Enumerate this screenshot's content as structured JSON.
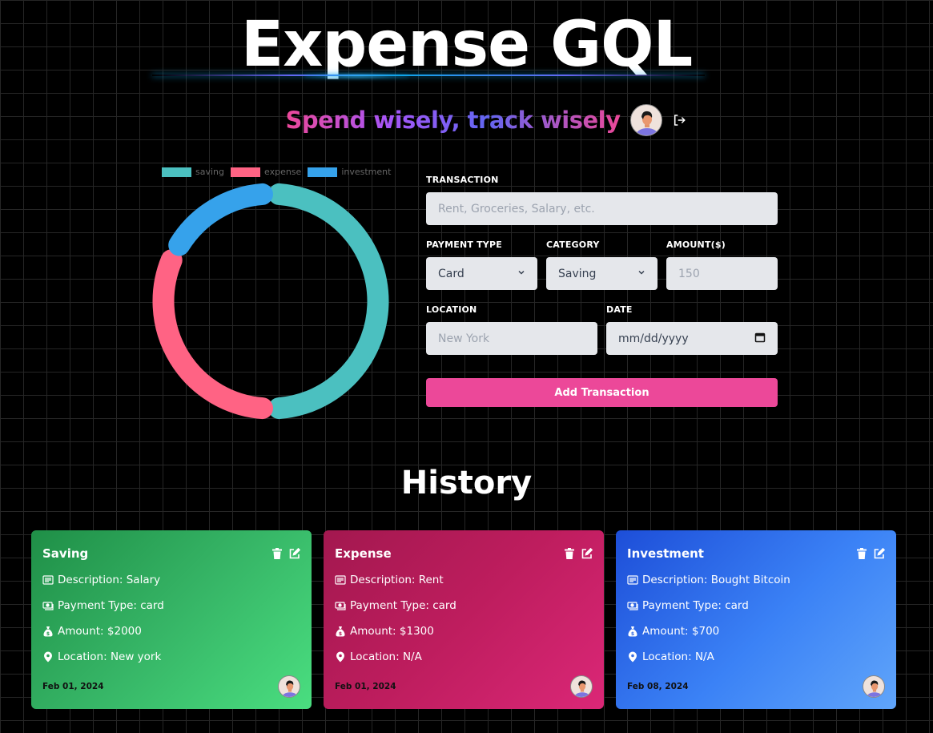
{
  "header": {
    "title": "Expense GQL",
    "subtitle": "Spend wisely, track wisely",
    "avatar_icon": "user-avatar",
    "logout_icon": "logout-icon"
  },
  "chart_data": {
    "type": "pie",
    "variant": "doughnut",
    "categories": [
      "saving",
      "expense",
      "investment"
    ],
    "values": [
      2000,
      1300,
      700
    ],
    "colors": [
      "#4BC0C0",
      "#FF6384",
      "#36A2EB"
    ],
    "legend": [
      "saving",
      "expense",
      "investment"
    ],
    "legend_position": "top",
    "title": ""
  },
  "form": {
    "transaction_label": "Transaction",
    "transaction_placeholder": "Rent, Groceries, Salary, etc.",
    "payment_type_label": "Payment Type",
    "payment_type_value": "Card",
    "category_label": "Category",
    "category_value": "Saving",
    "amount_label": "Amount($)",
    "amount_placeholder": "150",
    "location_label": "Location",
    "location_placeholder": "New York",
    "date_label": "Date",
    "date_placeholder": "mm/dd/yyyy",
    "submit_label": "Add Transaction"
  },
  "history": {
    "title": "History",
    "cards": [
      {
        "category": "Saving",
        "description": "Description: Salary",
        "payment_type": "Payment Type: card",
        "amount": "Amount: $2000",
        "location": "Location: New york",
        "date": "Feb 01, 2024",
        "color": "#22c55e"
      },
      {
        "category": "Expense",
        "description": "Description: Rent",
        "payment_type": "Payment Type: card",
        "amount": "Amount: $1300",
        "location": "Location: N/A",
        "date": "Feb 01, 2024",
        "color": "#db2777"
      },
      {
        "category": "Investment",
        "description": "Description: Bought Bitcoin",
        "payment_type": "Payment Type: card",
        "amount": "Amount: $700",
        "location": "Location: N/A",
        "date": "Feb 08, 2024",
        "color": "#3b82f6"
      }
    ]
  }
}
